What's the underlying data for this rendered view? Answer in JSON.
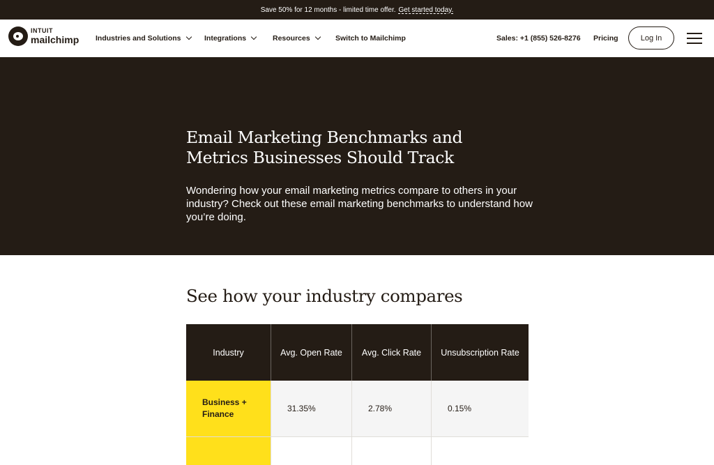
{
  "promo": {
    "text": "Save 50% for 12 months - limited time offer.",
    "link": "Get started today."
  },
  "logo": {
    "line1": "INTUIT",
    "line2": "mailchimp"
  },
  "nav": {
    "items": [
      {
        "label": "Industries and Solutions"
      },
      {
        "label": "Integrations"
      },
      {
        "label": "Resources"
      },
      {
        "label": "Switch to Mailchimp"
      }
    ],
    "sales": "Sales: +1 (855) 526-8276",
    "pricing": "Pricing",
    "login": "Log In"
  },
  "hero": {
    "title": "Email Marketing Benchmarks and Metrics Businesses Should Track",
    "subtitle": "Wondering how your email marketing metrics compare to others in your industry? Check out these email marketing benchmarks to understand how you’re doing."
  },
  "section": {
    "title": "See how your industry compares"
  },
  "table": {
    "headers": [
      "Industry",
      "Avg. Open Rate",
      "Avg. Click Rate",
      "Unsubscription Rate"
    ],
    "rows": [
      {
        "industry": "Business + Finance",
        "open": "31.35%",
        "click": "2.78%",
        "unsub": "0.15%"
      }
    ]
  },
  "colors": {
    "dark": "#241c15",
    "accent": "#ffe01b"
  }
}
